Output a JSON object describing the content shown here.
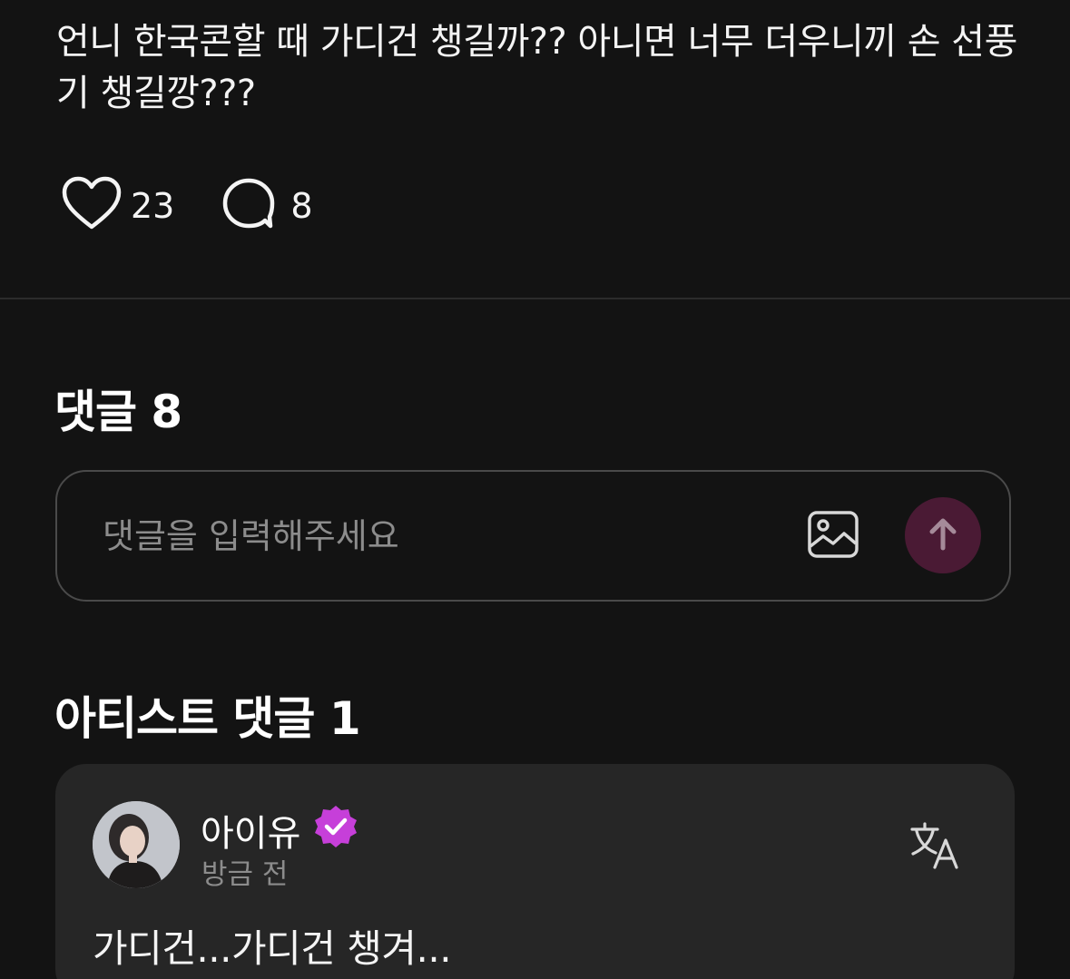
{
  "post": {
    "text": "언니 한국콘할 때 가디건 챙길까?? 아니면 너무 더우니끼 손 선풍기 챙길깡???"
  },
  "reactions": {
    "likes": {
      "icon": "heart-icon",
      "count": "23"
    },
    "comments": {
      "icon": "speech-bubble-icon",
      "count": "8"
    }
  },
  "comments_section": {
    "title": "댓글 8",
    "input_placeholder": "댓글을 입력해주세요",
    "image_icon": "image-icon",
    "send_icon": "arrow-up-icon",
    "send_color": "#4a1a34"
  },
  "artist_section": {
    "title": "아티스트 댓글 1",
    "comment": {
      "author": "아이유",
      "verified_icon": "verified-badge-icon",
      "verified_color": "#c63fd9",
      "time": "방금 전",
      "translate_icon": "translate-icon",
      "text": "가디건...가디건 챙겨..."
    }
  }
}
